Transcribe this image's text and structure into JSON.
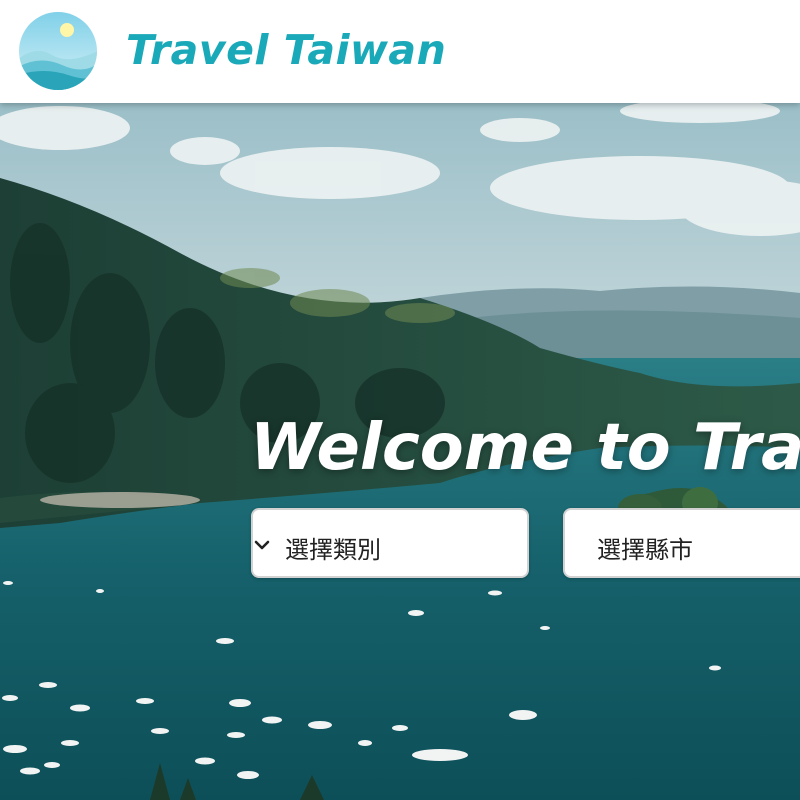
{
  "header": {
    "brand": "Travel Taiwan",
    "logo_icon": "landscape-sun-logo-icon"
  },
  "hero": {
    "welcome_text": "Welcome to Trav",
    "category_select": {
      "selected": "選擇類別",
      "icon": "chevron-down-icon"
    },
    "city_select": {
      "selected": "選擇縣市"
    }
  },
  "colors": {
    "brand": "#1aa9b8",
    "header_bg": "#ffffff",
    "lake": "#0f5a63"
  }
}
